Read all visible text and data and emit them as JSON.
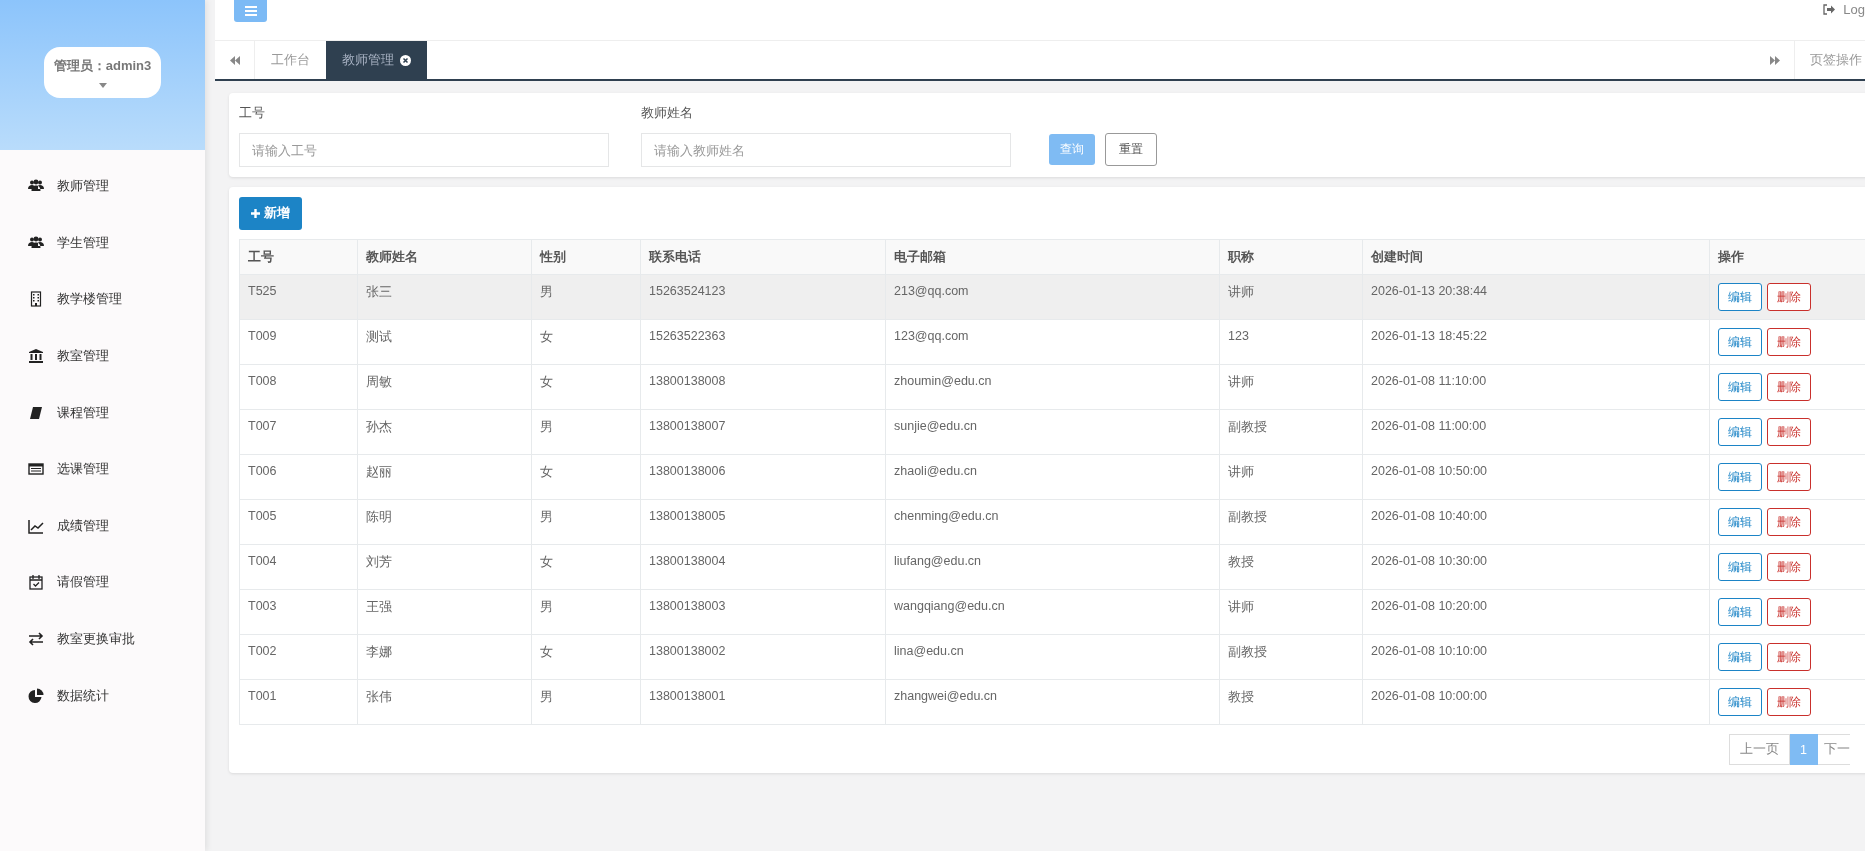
{
  "sidebar": {
    "user": "管理员：admin3",
    "items": [
      {
        "label": "教师管理"
      },
      {
        "label": "学生管理"
      },
      {
        "label": "教学楼管理"
      },
      {
        "label": "教室管理"
      },
      {
        "label": "课程管理"
      },
      {
        "label": "选课管理"
      },
      {
        "label": "成绩管理"
      },
      {
        "label": "请假管理"
      },
      {
        "label": "教室更换审批"
      },
      {
        "label": "数据统计"
      }
    ]
  },
  "topbar": {
    "logout": "Log"
  },
  "tabs": [
    {
      "label": "工作台",
      "selected": false,
      "closable": false
    },
    {
      "label": "教师管理",
      "selected": true,
      "closable": true
    }
  ],
  "tab_menu": "页签操作",
  "search": {
    "fields": [
      {
        "label": "工号",
        "placeholder": "请输入工号"
      },
      {
        "label": "教师姓名",
        "placeholder": "请输入教师姓名"
      }
    ],
    "query": "查询",
    "reset": "重置"
  },
  "add_button": "新增",
  "table": {
    "columns": [
      "工号",
      "教师姓名",
      "性别",
      "联系电话",
      "电子邮箱",
      "职称",
      "创建时间",
      "操作"
    ],
    "rows": [
      {
        "cells": [
          "T525",
          "张三",
          "男",
          "15263524123",
          "213@qq.com",
          "讲师",
          "2026-01-13 20:38:44"
        ],
        "highlighted": true
      },
      {
        "cells": [
          "T009",
          "测试",
          "女",
          "15263522363",
          "123@qq.com",
          "123",
          "2026-01-13 18:45:22"
        ],
        "highlighted": false
      },
      {
        "cells": [
          "T008",
          "周敏",
          "女",
          "13800138008",
          "zhoumin@edu.cn",
          "讲师",
          "2026-01-08 11:10:00"
        ],
        "highlighted": false
      },
      {
        "cells": [
          "T007",
          "孙杰",
          "男",
          "13800138007",
          "sunjie@edu.cn",
          "副教授",
          "2026-01-08 11:00:00"
        ],
        "highlighted": false
      },
      {
        "cells": [
          "T006",
          "赵丽",
          "女",
          "13800138006",
          "zhaoli@edu.cn",
          "讲师",
          "2026-01-08 10:50:00"
        ],
        "highlighted": false
      },
      {
        "cells": [
          "T005",
          "陈明",
          "男",
          "13800138005",
          "chenming@edu.cn",
          "副教授",
          "2026-01-08 10:40:00"
        ],
        "highlighted": false
      },
      {
        "cells": [
          "T004",
          "刘芳",
          "女",
          "13800138004",
          "liufang@edu.cn",
          "教授",
          "2026-01-08 10:30:00"
        ],
        "highlighted": false
      },
      {
        "cells": [
          "T003",
          "王强",
          "男",
          "13800138003",
          "wangqiang@edu.cn",
          "讲师",
          "2026-01-08 10:20:00"
        ],
        "highlighted": false
      },
      {
        "cells": [
          "T002",
          "李娜",
          "女",
          "13800138002",
          "lina@edu.cn",
          "副教授",
          "2026-01-08 10:10:00"
        ],
        "highlighted": false
      },
      {
        "cells": [
          "T001",
          "张伟",
          "男",
          "13800138001",
          "zhangwei@edu.cn",
          "教授",
          "2026-01-08 10:00:00"
        ],
        "highlighted": false
      }
    ],
    "actions": [
      [
        "编辑",
        "删除"
      ],
      [
        "编辑",
        "删除"
      ],
      [
        "编辑",
        "删除"
      ],
      [
        "编辑",
        "删除"
      ],
      [
        "编辑",
        "删除"
      ],
      [
        "编辑",
        "删除"
      ],
      [
        "编辑",
        "删除"
      ],
      [
        "编辑",
        "删除"
      ],
      [
        "编辑",
        "删除"
      ],
      [
        "编辑",
        "删除"
      ]
    ]
  },
  "pagination": {
    "prev": "上一页",
    "pages": [
      {
        "label": "1",
        "selected": true
      }
    ],
    "next": "下一"
  }
}
